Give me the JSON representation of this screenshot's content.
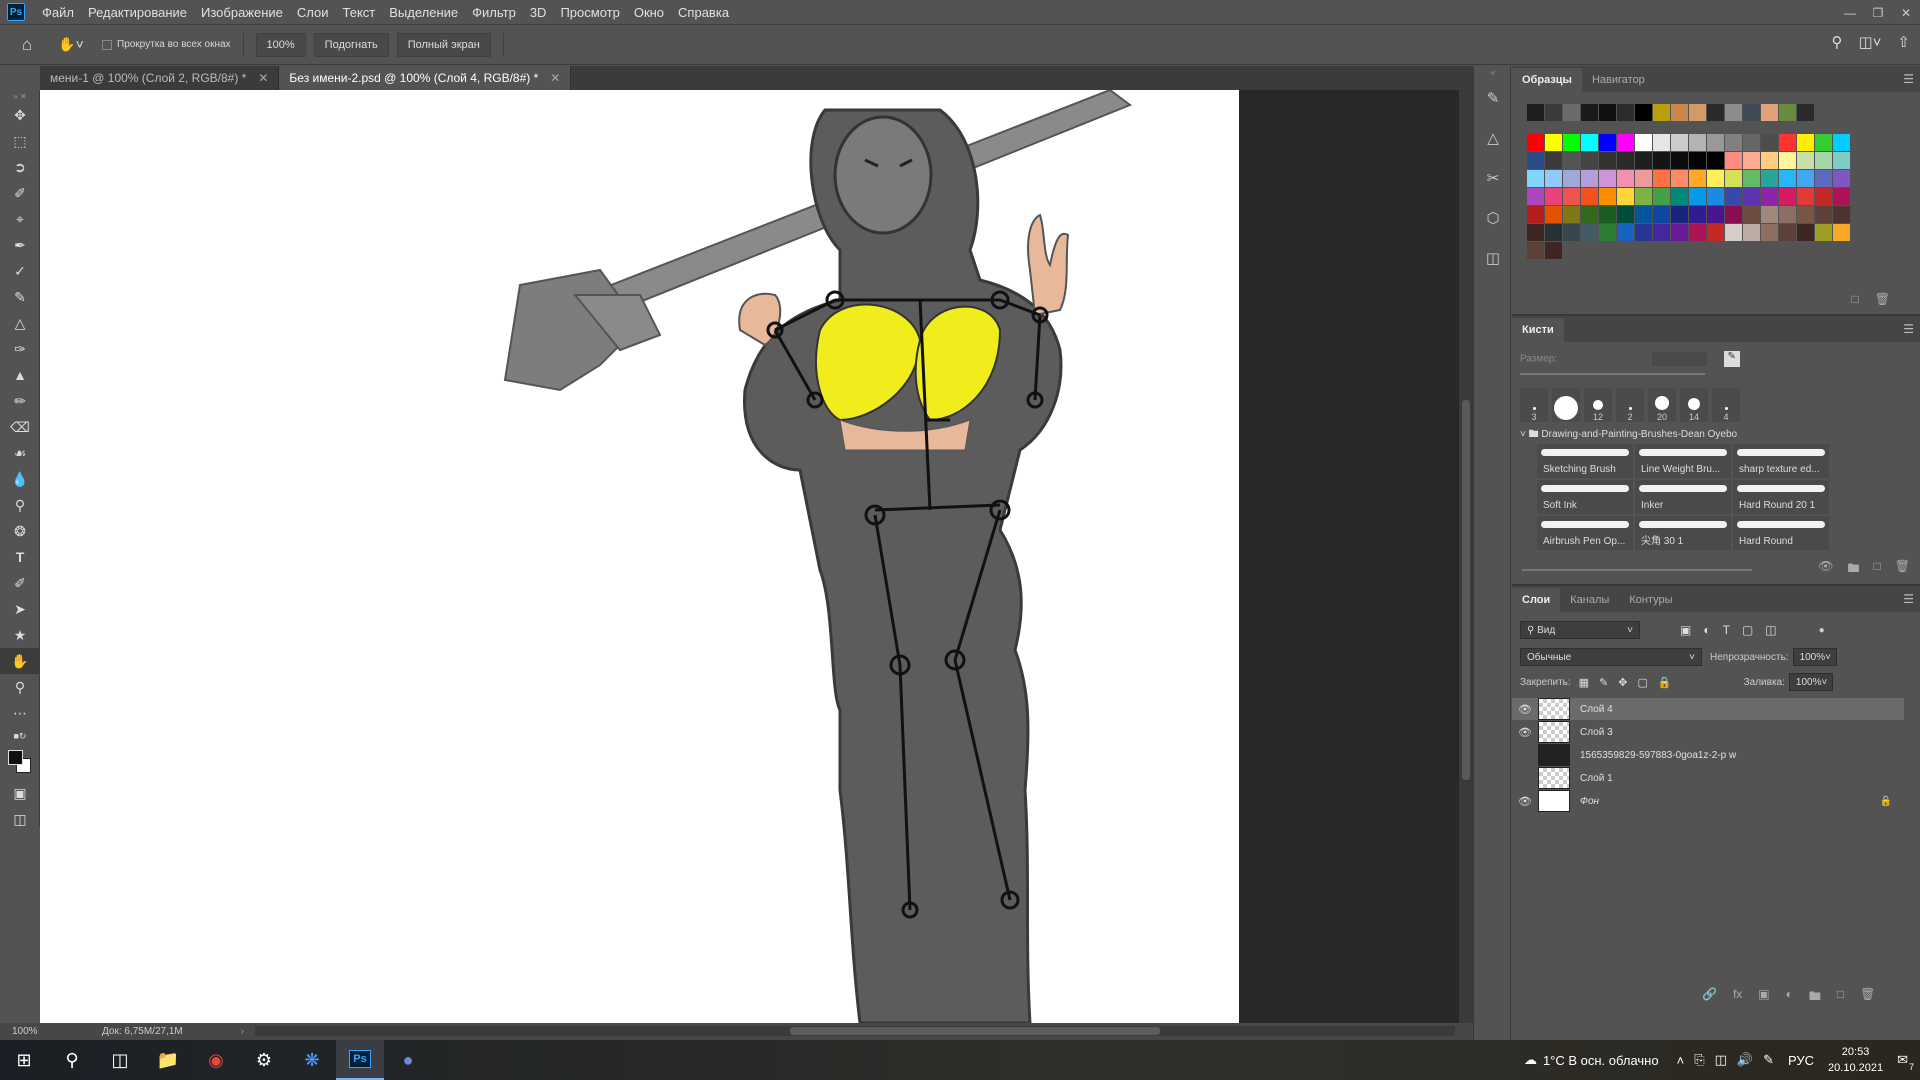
{
  "menubar": {
    "logo": "Ps",
    "items": [
      "Файл",
      "Редактирование",
      "Изображение",
      "Слои",
      "Текст",
      "Выделение",
      "Фильтр",
      "3D",
      "Просмотр",
      "Окно",
      "Справка"
    ]
  },
  "options": {
    "scroll_all_label": "Прокрутка во всех окнах",
    "zoom_value": "100%",
    "fit_label": "Подогнать",
    "fullscreen_label": "Полный экран"
  },
  "tabs": [
    {
      "label": "мени-1 @ 100% (Слой 2, RGB/8#) *",
      "active": false
    },
    {
      "label": "Без имени-2.psd @ 100% (Слой 4, RGB/8#) *",
      "active": true
    }
  ],
  "status": {
    "zoom": "100%",
    "doc": "Док: 6,75M/27,1M"
  },
  "swatches": {
    "tabs": [
      "Образцы",
      "Навигатор"
    ],
    "recent": [
      "#1e1e1e",
      "#3a3a3a",
      "#6b6b6b",
      "#1a1a1a",
      "#101010",
      "#2c2c2c",
      "#000000",
      "#b7a00a",
      "#c9874a",
      "#d39a66",
      "#2a2a2a",
      "#8c8c8c",
      "#3f4a56",
      "#e0a27a",
      "#6a8a40",
      "#2b2b2b"
    ],
    "grid": [
      [
        "#ff0000",
        "#ffff00",
        "#00ff00",
        "#00ffff",
        "#0000ff",
        "#ff00ff",
        "#ffffff",
        "#e6e6e6",
        "#cccccc",
        "#b3b3b3",
        "#999999",
        "#808080",
        "#666666",
        "#4d4d4d",
        "#ff3333",
        "#ffee00",
        "#33cc33",
        "#00ccff"
      ],
      [
        "#2a4a8a",
        "#3a3a3a",
        "#555555",
        "#444444",
        "#333333",
        "#2a2a2a",
        "#1f1f1f",
        "#151515",
        "#0d0d0d",
        "#050505",
        "#000000",
        "#ff8a80",
        "#ffab91",
        "#ffcc80",
        "#fff59d",
        "#c5e1a5",
        "#a5d6a7",
        "#80cbc4"
      ],
      [
        "#81d4fa",
        "#90caf9",
        "#9fa8da",
        "#b39ddb",
        "#ce93d8",
        "#f48fb1",
        "#ef9a9a",
        "#ff7043",
        "#ff8a65",
        "#ffa726",
        "#ffee58",
        "#d4e157",
        "#66bb6a",
        "#26a69a",
        "#29b6f6",
        "#42a5f5",
        "#5c6bc0",
        "#7e57c2"
      ],
      [
        "#ab47bc",
        "#ec407a",
        "#ef5350",
        "#f4511e",
        "#fb8c00",
        "#fdd835",
        "#7cb342",
        "#43a047",
        "#00897b",
        "#039be5",
        "#1e88e5",
        "#3949ab",
        "#5e35b1",
        "#8e24aa",
        "#d81b60",
        "#e53935",
        "#c62828",
        "#ad1457"
      ],
      [
        "#b71c1c",
        "#e65100",
        "#827717",
        "#33691e",
        "#1b5e20",
        "#004d40",
        "#01579b",
        "#0d47a1",
        "#1a237e",
        "#311b92",
        "#4a148c",
        "#880e4f",
        "#6d4c41",
        "#a1887f",
        "#8d6e63",
        "#795548",
        "#5d4037",
        "#4e342e"
      ],
      [
        "#3e2723",
        "#263238",
        "#37474f",
        "#455a64",
        "#2e7d32",
        "#1565c0",
        "#283593",
        "#4527a0",
        "#6a1b9a",
        "#ad1457",
        "#c62828",
        "#d7ccc8",
        "#bcaaa4",
        "#8d6e63",
        "#5d4037",
        "#3e2723",
        "#9e9d24",
        "#f9a825"
      ],
      [
        "#5d4037",
        "#3e2723"
      ]
    ]
  },
  "brushes": {
    "title": "Кисти",
    "size_label": "Размер:",
    "tips": [
      "3",
      "",
      "12",
      "2",
      "20",
      "14",
      "4"
    ],
    "folder": "Drawing-and-Painting-Brushes-Dean Oyebo",
    "items": [
      "Sketching Brush",
      "Line Weight Bru...",
      "sharp texture ed...",
      "Soft Ink",
      "Inker",
      "Hard Round 20 1",
      "Airbrush Pen Op...",
      "尖角 30 1",
      "Hard Round"
    ]
  },
  "layers": {
    "tabs": [
      "Слои",
      "Каналы",
      "Контуры"
    ],
    "filter_label": "Вид",
    "blend_mode": "Обычные",
    "opacity_label": "Непрозрачность:",
    "opacity_value": "100%",
    "lock_label": "Закрепить:",
    "fill_label": "Заливка:",
    "fill_value": "100%",
    "items": [
      {
        "name": "Слой 4",
        "visible": true,
        "selected": true
      },
      {
        "name": "Слой 3",
        "visible": true,
        "selected": false
      },
      {
        "name": "1565359829-597883-0goa1z-2-p w",
        "visible": false,
        "selected": false
      },
      {
        "name": "Слой 1",
        "visible": false,
        "selected": false
      },
      {
        "name": "Фон",
        "visible": true,
        "selected": false
      }
    ]
  },
  "taskbar": {
    "weather": "1°C  В осн. облачно",
    "lang": "РУС",
    "time": "20:53",
    "date": "20.10.2021",
    "notif_count": "7"
  },
  "colors": {
    "accent_yellow": "#f1ec1c",
    "figure_gray": "#5c5c5c",
    "skin": "#e8b89a"
  }
}
